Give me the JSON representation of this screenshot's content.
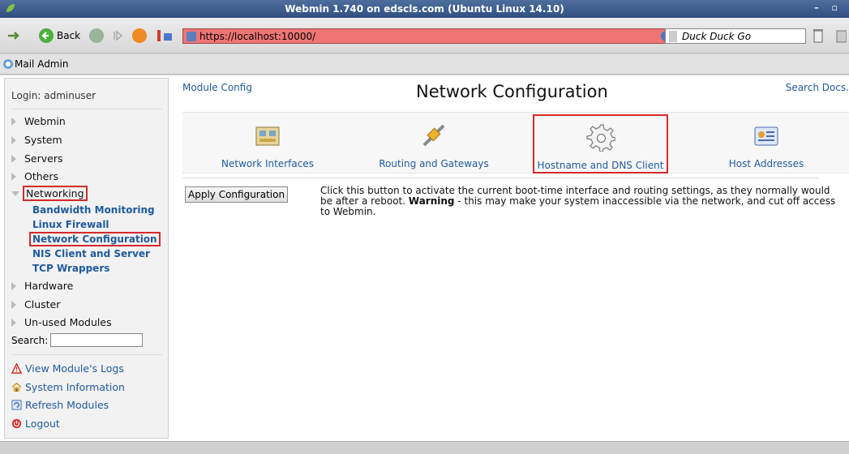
{
  "window": {
    "title": "Webmin 1.740 on edscls.com (Ubuntu Linux 14.10)"
  },
  "navbar": {
    "back_label": "Back",
    "url": "https://localhost:10000/",
    "search_engine": "Duck Duck Go"
  },
  "bookmarks": {
    "item": "Mail Admin"
  },
  "sidebar": {
    "login": "Login: adminuser",
    "categories": {
      "webmin": "Webmin",
      "system": "System",
      "servers": "Servers",
      "others": "Others",
      "networking": "Networking",
      "hardware": "Hardware",
      "cluster": "Cluster",
      "unused": "Un-used Modules"
    },
    "networking_items": [
      "Bandwidth Monitoring",
      "Linux Firewall",
      "Network Configuration",
      "NIS Client and Server",
      "TCP Wrappers"
    ],
    "search_label": "Search:",
    "actions": {
      "logs": "View Module's Logs",
      "sysinfo": "System Information",
      "refresh": "Refresh Modules",
      "logout": "Logout"
    }
  },
  "main": {
    "module_config": "Module Config",
    "title": "Network Configuration",
    "search_docs": "Search Docs.",
    "tiles": [
      {
        "label": "Network Interfaces",
        "icon": "network-card-icon"
      },
      {
        "label": "Routing and Gateways",
        "icon": "cable-plug-icon"
      },
      {
        "label": "Hostname and DNS Client",
        "icon": "gear-icon"
      },
      {
        "label": "Host Addresses",
        "icon": "address-card-icon"
      }
    ],
    "apply_button": "Apply Configuration",
    "description_part1": "Click this button to activate the current boot-time interface and routing settings, as they normally would be after a reboot.",
    "description_warning": "Warning",
    "description_part2": "- this may make your system inaccessible via the network, and cut off access to Webmin."
  },
  "colors": {
    "link": "#1f5a9c",
    "highlight_box": "#d42a2a",
    "urlbar_bg": "#ef7575",
    "titlebar": "#3b5b8c"
  }
}
